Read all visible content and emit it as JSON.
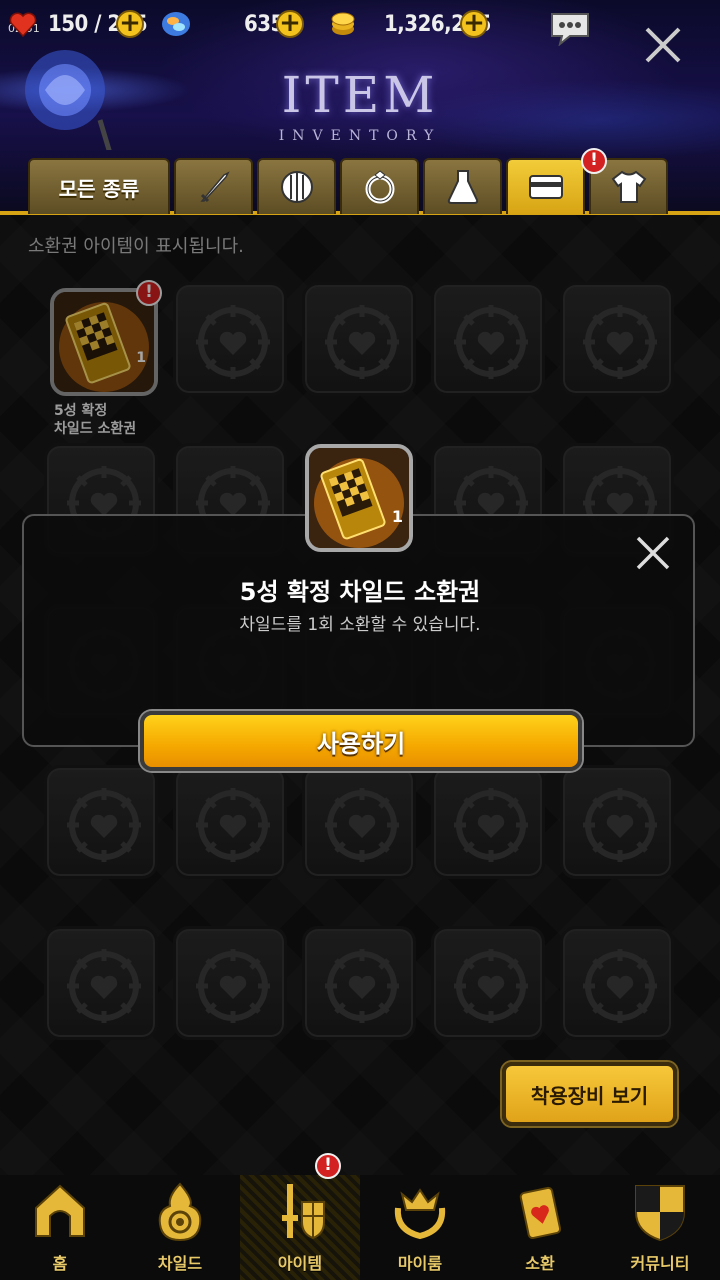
{
  "status": {
    "time": "02:51",
    "stamina": "150 / 265",
    "gems": "635",
    "gold": "1,326,275"
  },
  "header": {
    "title": "ITEM",
    "subtitle": "INVENTORY"
  },
  "tabs": [
    {
      "label": "모든 종류",
      "icon": "all-types"
    },
    {
      "label": "",
      "icon": "sword-icon"
    },
    {
      "label": "",
      "icon": "shield-icon"
    },
    {
      "label": "",
      "icon": "ring-icon"
    },
    {
      "label": "",
      "icon": "potion-icon"
    },
    {
      "label": "",
      "icon": "ticket-icon",
      "active": true,
      "badge": "!"
    },
    {
      "label": "",
      "icon": "shirt-icon"
    }
  ],
  "info_text": "소환권 아이템이 표시됩니다.",
  "inventory": {
    "item": {
      "name_line1": "5성 확정",
      "name_line2": "차일드 소환권",
      "count": "1",
      "badge": "!"
    }
  },
  "popup": {
    "title": "5성 확정 차일드 소환권",
    "description": "차일드를 1회 소환할 수 있습니다.",
    "count": "1",
    "use_label": "사용하기"
  },
  "equip_button": "착용장비 보기",
  "nav": {
    "items": [
      {
        "label": "홈",
        "icon": "home-icon"
      },
      {
        "label": "차일드",
        "icon": "child-flame-icon"
      },
      {
        "label": "아이템",
        "icon": "item-sword-shield-icon",
        "active": true,
        "badge": "!"
      },
      {
        "label": "마이룸",
        "icon": "crown-wreath-icon"
      },
      {
        "label": "소환",
        "icon": "summon-card-icon"
      },
      {
        "label": "커뮤니티",
        "icon": "community-shield-icon"
      }
    ]
  },
  "colors": {
    "accent_gold": "#d5a313",
    "alert_red": "#d32020",
    "button_orange": "#f5a800"
  }
}
